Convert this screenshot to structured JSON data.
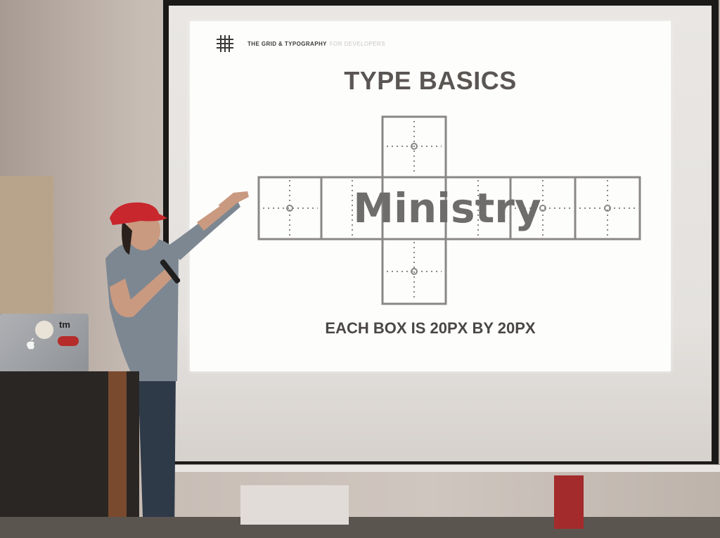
{
  "slide": {
    "header_bold": "THE GRID & TYPOGRAPHY",
    "header_light": "FOR DEVELOPERS",
    "title": "TYPE BASICS",
    "sample_word": "Ministry",
    "caption": "EACH BOX IS 20PX BY 20PX"
  },
  "laptop": {
    "sticker_tm": "tm"
  },
  "colors": {
    "accent_red": "#d9453a",
    "box_stroke": "#8a8886",
    "word_gray": "#6f6d6b",
    "cap_red": "#c8272d"
  },
  "icons": {
    "grid_logo": "hash-grid-icon",
    "apple": "apple-logo-icon"
  }
}
